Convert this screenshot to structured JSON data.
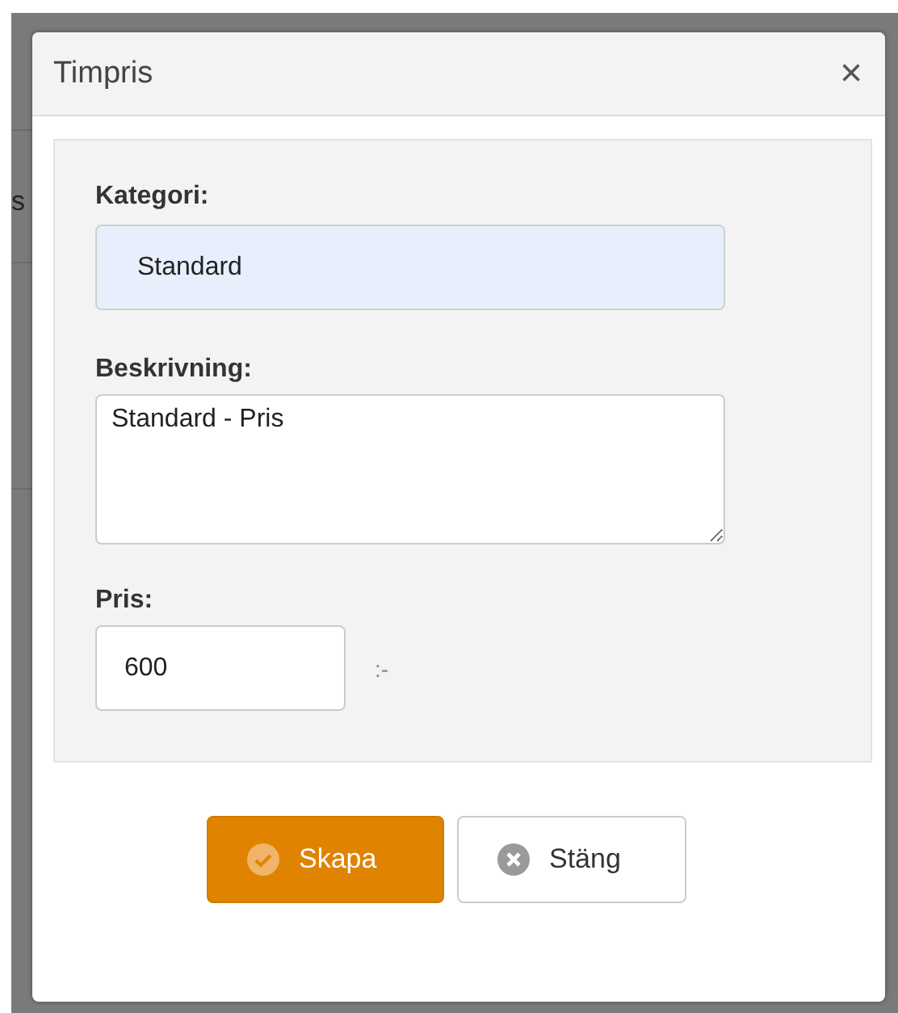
{
  "background_page": {
    "text_fragment": "s"
  },
  "dialog": {
    "title": "Timpris",
    "close": "×"
  },
  "form": {
    "category": {
      "label": "Kategori:",
      "value": "Standard"
    },
    "description": {
      "label": "Beskrivning:",
      "value": "Standard - Pris"
    },
    "price": {
      "label": "Pris:",
      "value": "600",
      "suffix": ":-"
    }
  },
  "buttons": [
    {
      "kind": "primary",
      "label": "Skapa"
    },
    {
      "kind": "secondary",
      "label": "Stäng"
    }
  ]
}
